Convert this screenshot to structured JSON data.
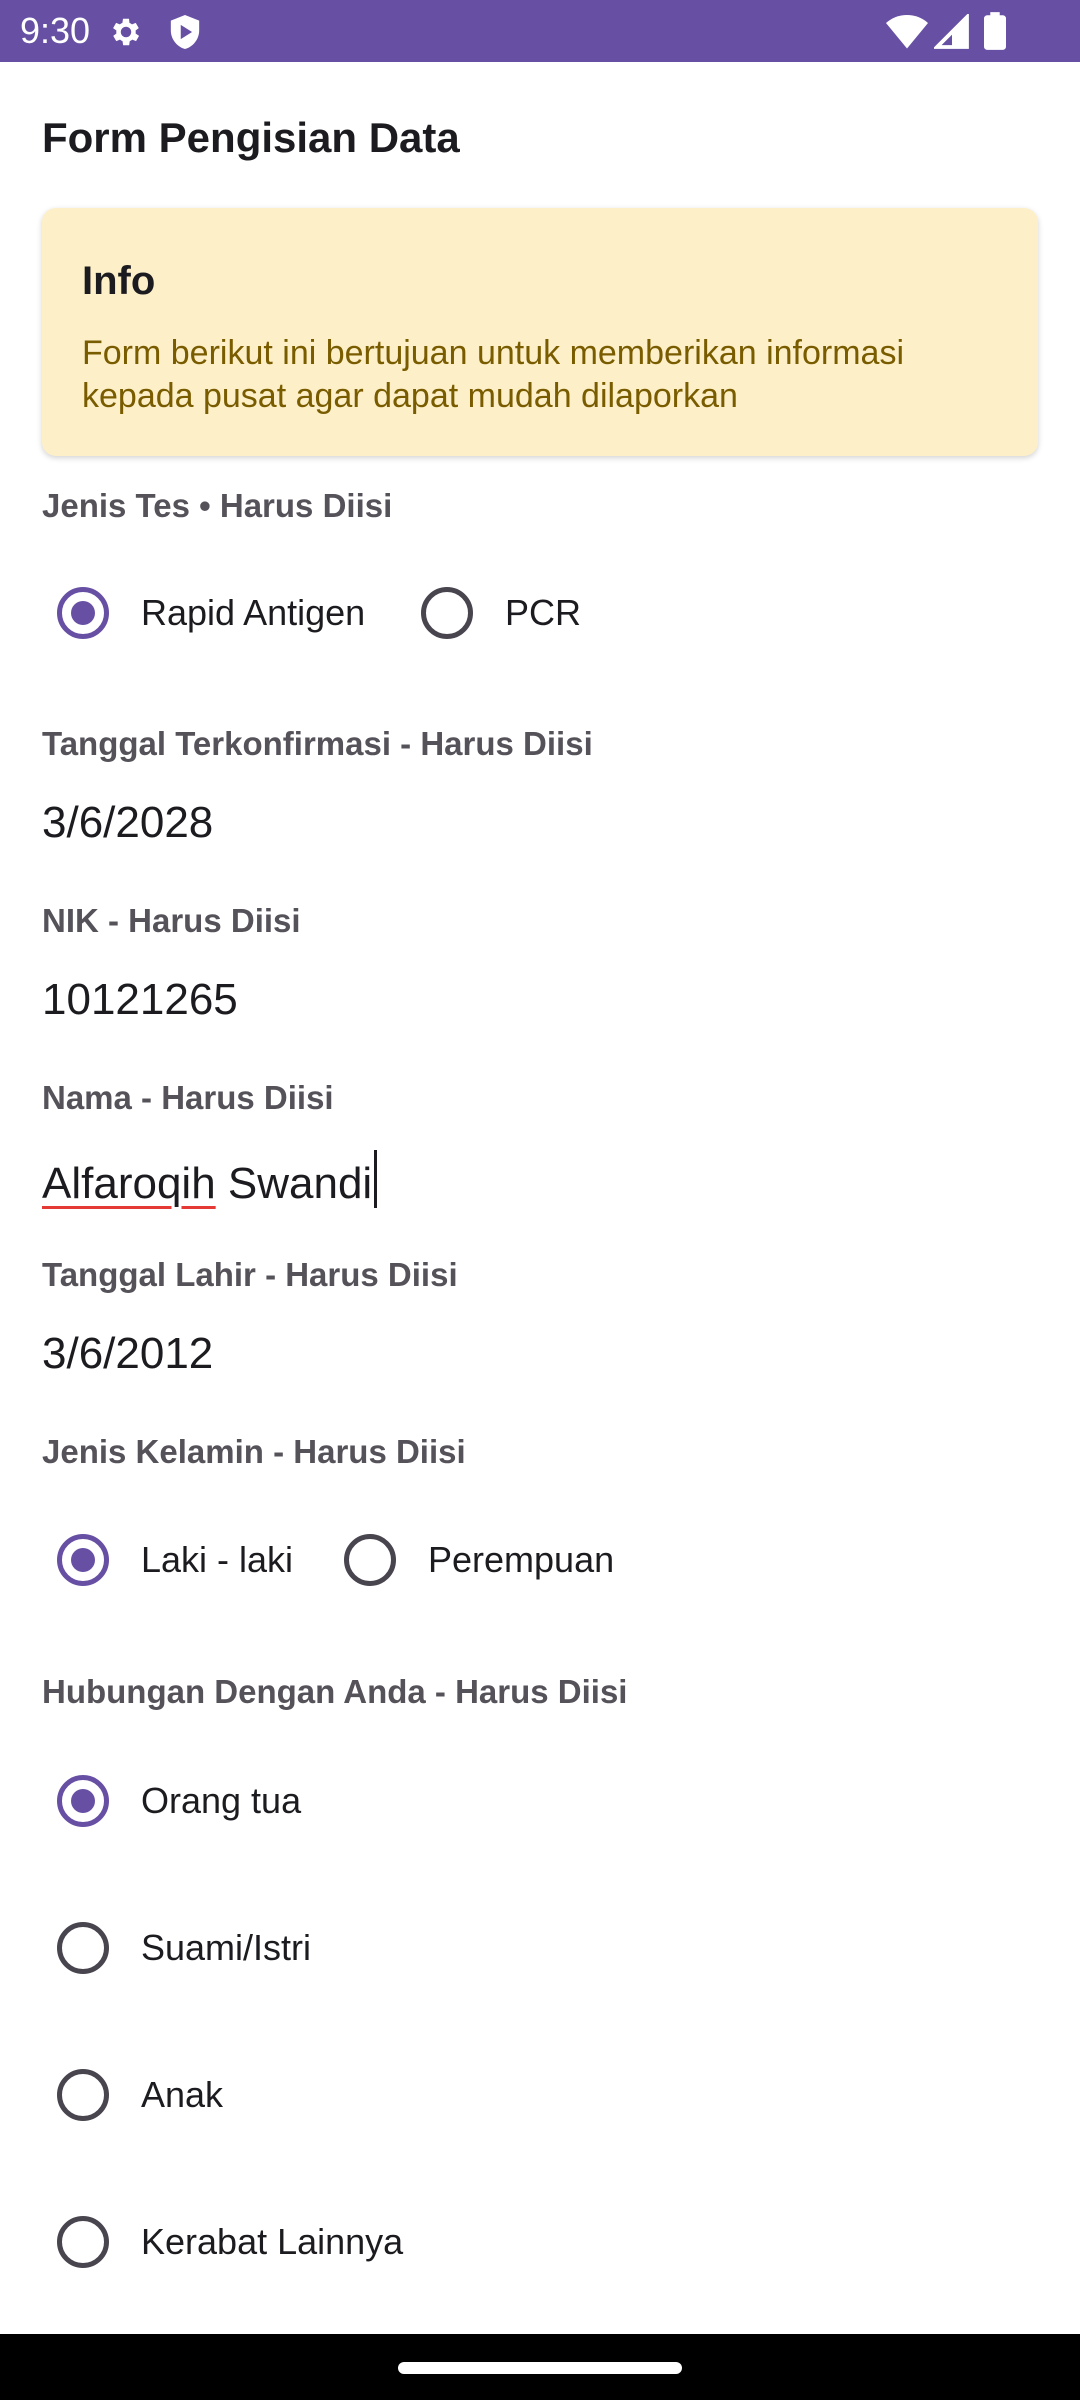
{
  "status_bar": {
    "time": "9:30",
    "icons": [
      "gear-icon",
      "shield-icon",
      "wifi-icon",
      "signal-icon",
      "battery-icon"
    ],
    "color": "#6750a4"
  },
  "page_title": "Form Pengisian Data",
  "info": {
    "title": "Info",
    "text": "Form berikut ini bertujuan untuk memberikan informasi kepada pusat agar dapat mudah dilaporkan",
    "background": "#fdf0c8",
    "text_color": "#7a5c00"
  },
  "jenis_tes": {
    "label": "Jenis Tes • Harus Diisi",
    "options": [
      {
        "label": "Rapid Antigen",
        "selected": true
      },
      {
        "label": "PCR",
        "selected": false
      }
    ]
  },
  "tanggal_terkonfirmasi": {
    "label": "Tanggal Terkonfirmasi - Harus Diisi",
    "value": "3/6/2028"
  },
  "nik": {
    "label": "NIK - Harus Diisi",
    "value": "10121265"
  },
  "nama": {
    "label": "Nama - Harus Diisi",
    "value_first": "Alfaroqih",
    "value_rest": " Swandi"
  },
  "tanggal_lahir": {
    "label": "Tanggal Lahir - Harus Diisi",
    "value": "3/6/2012"
  },
  "jenis_kelamin": {
    "label": "Jenis Kelamin - Harus Diisi",
    "options": [
      {
        "label": "Laki - laki",
        "selected": true
      },
      {
        "label": "Perempuan",
        "selected": false
      }
    ]
  },
  "hubungan": {
    "label": "Hubungan Dengan Anda - Harus Diisi",
    "options": [
      {
        "label": "Orang tua",
        "selected": true
      },
      {
        "label": "Suami/Istri",
        "selected": false
      },
      {
        "label": "Anak",
        "selected": false
      },
      {
        "label": "Kerabat Lainnya",
        "selected": false
      }
    ]
  },
  "accent_color": "#6750a4"
}
